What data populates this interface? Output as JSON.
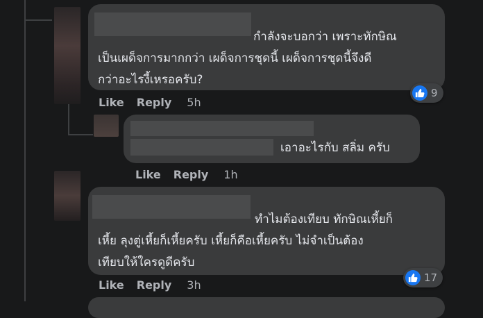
{
  "comments": [
    {
      "text": "กำลังจะบอกว่า เพราะทักษิณ\nเป็นเผด็จการมากกว่า เผด็จการชุดนี้ เผด็จการชุดนี้จึงดี\nกว่าอะไรงี้เหรอครับ?",
      "like_label": "Like",
      "reply_label": "Reply",
      "time": "5h",
      "reaction_count": "9"
    },
    {
      "text": "เอาอะไรกับ สลิ่ม ครับ",
      "like_label": "Like",
      "reply_label": "Reply",
      "time": "1h"
    },
    {
      "text": "ทำไมต้องเทียบ ทักษิณเหี้ยก็\nเหี้ย ลุงตู่เหี้ยก็เหี้ยครับ เหี้ยก็คือเหี้ยครับ ไม่จำเป็นต้อง\nเทียบให้ใครดูดีครับ",
      "like_label": "Like",
      "reply_label": "Reply",
      "time": "3h",
      "reaction_count": "17"
    }
  ],
  "colors": {
    "background": "#18191a",
    "bubble": "#3a3b3c",
    "like_blue": "#1877f2",
    "text": "#e4e6eb",
    "muted": "#b0b3b8"
  }
}
